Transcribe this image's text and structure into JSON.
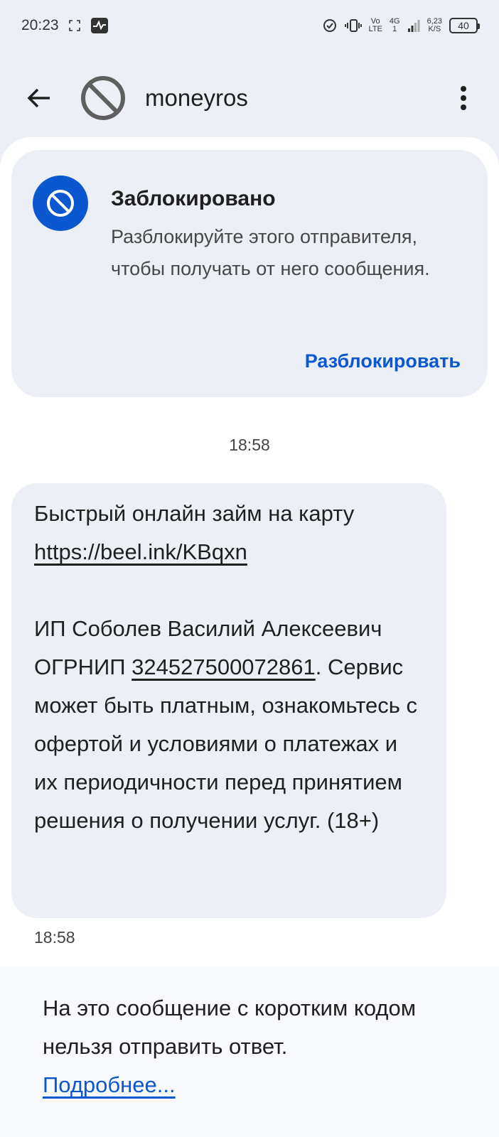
{
  "status_bar": {
    "time": "20:23",
    "net_top": "Vo",
    "net_bottom": "LTE",
    "signal_top": "4G",
    "signal_bottom": "1",
    "speed_top": "6,23",
    "speed_bottom": "K/S",
    "battery": "40"
  },
  "header": {
    "title": "moneyros"
  },
  "blocked": {
    "title": "Заблокировано",
    "description": "Разблокируйте этого отправителя, чтобы получать от него сообщения.",
    "action": "Разблокировать"
  },
  "conversation": {
    "date_time": "18:58",
    "message": {
      "line1": "Быстрый онлайн займ на карту",
      "link": "https://beel.ink/KBqxn",
      "p2_before": "ИП Соболев Василий Алексеевич ОГРНИП ",
      "ogrnip": "324527500072861",
      "p2_after": ". Сервис может быть платным, ознакомьтесь с офертой и условиями о платежах и их периодичности перед принятием решения о получении услуг. (18+)"
    },
    "message_time": "18:58"
  },
  "footer": {
    "text": "На это сообщение с коротким кодом нельзя отправить ответ.",
    "link": "Подробнее..."
  },
  "colors": {
    "accent": "#0b57d0",
    "background": "#ecf0f6",
    "sheet": "#ffffff"
  }
}
